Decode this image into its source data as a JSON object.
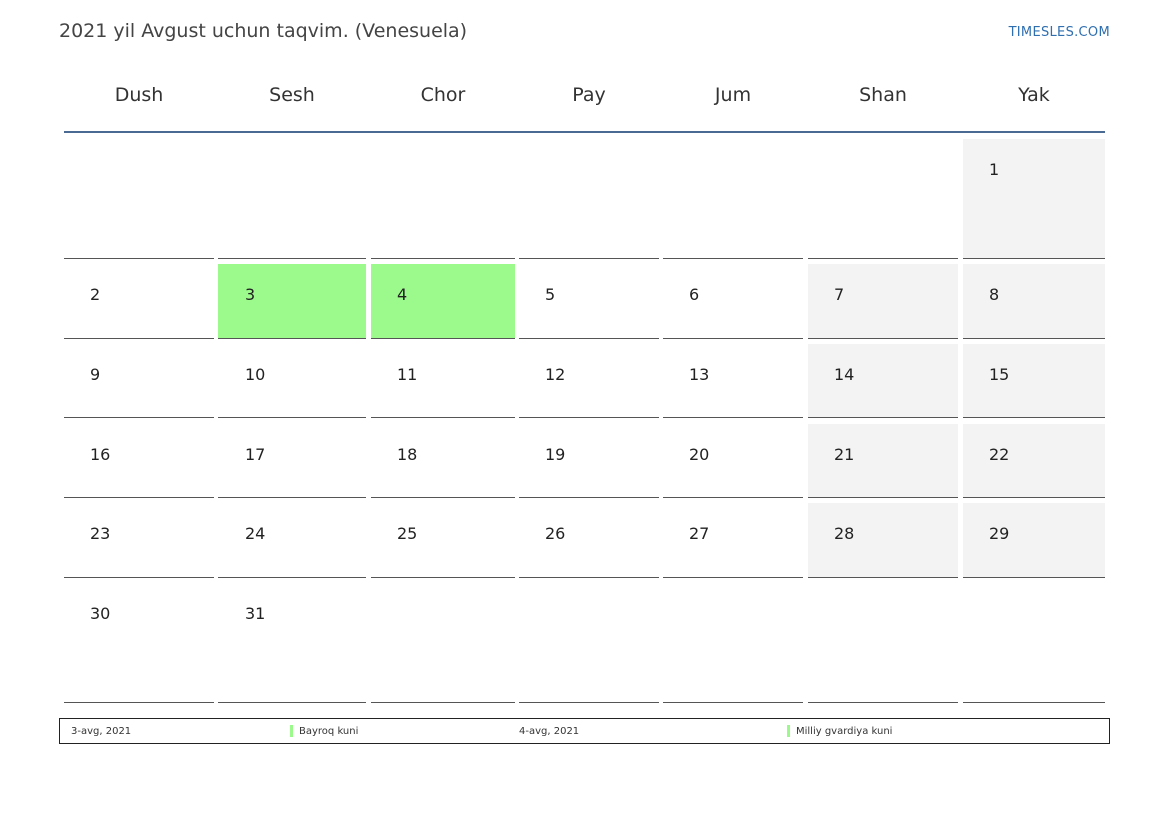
{
  "header": {
    "title": "2021 yil Avgust uchun taqvim. (Venesuela)",
    "brand": "TIMESLES.COM"
  },
  "weekdays": [
    "Dush",
    "Sesh",
    "Chor",
    "Pay",
    "Jum",
    "Shan",
    "Yak"
  ],
  "weeks": [
    [
      null,
      null,
      null,
      null,
      null,
      null,
      "1"
    ],
    [
      "2",
      "3",
      "4",
      "5",
      "6",
      "7",
      "8"
    ],
    [
      "9",
      "10",
      "11",
      "12",
      "13",
      "14",
      "15"
    ],
    [
      "16",
      "17",
      "18",
      "19",
      "20",
      "21",
      "22"
    ],
    [
      "23",
      "24",
      "25",
      "26",
      "27",
      "28",
      "29"
    ],
    [
      "30",
      "31",
      null,
      null,
      null,
      null,
      null
    ]
  ],
  "holidays": [
    "3",
    "4"
  ],
  "colors": {
    "holiday": "#9cf98b",
    "weekend": "#f3f3f3",
    "header_rule": "#4a6a93",
    "brand": "#2f6fb0"
  },
  "legend": [
    {
      "date": "3-avg, 2021",
      "name": "Bayroq kuni"
    },
    {
      "date": "4-avg, 2021",
      "name": "Milliy gvardiya kuni"
    }
  ]
}
